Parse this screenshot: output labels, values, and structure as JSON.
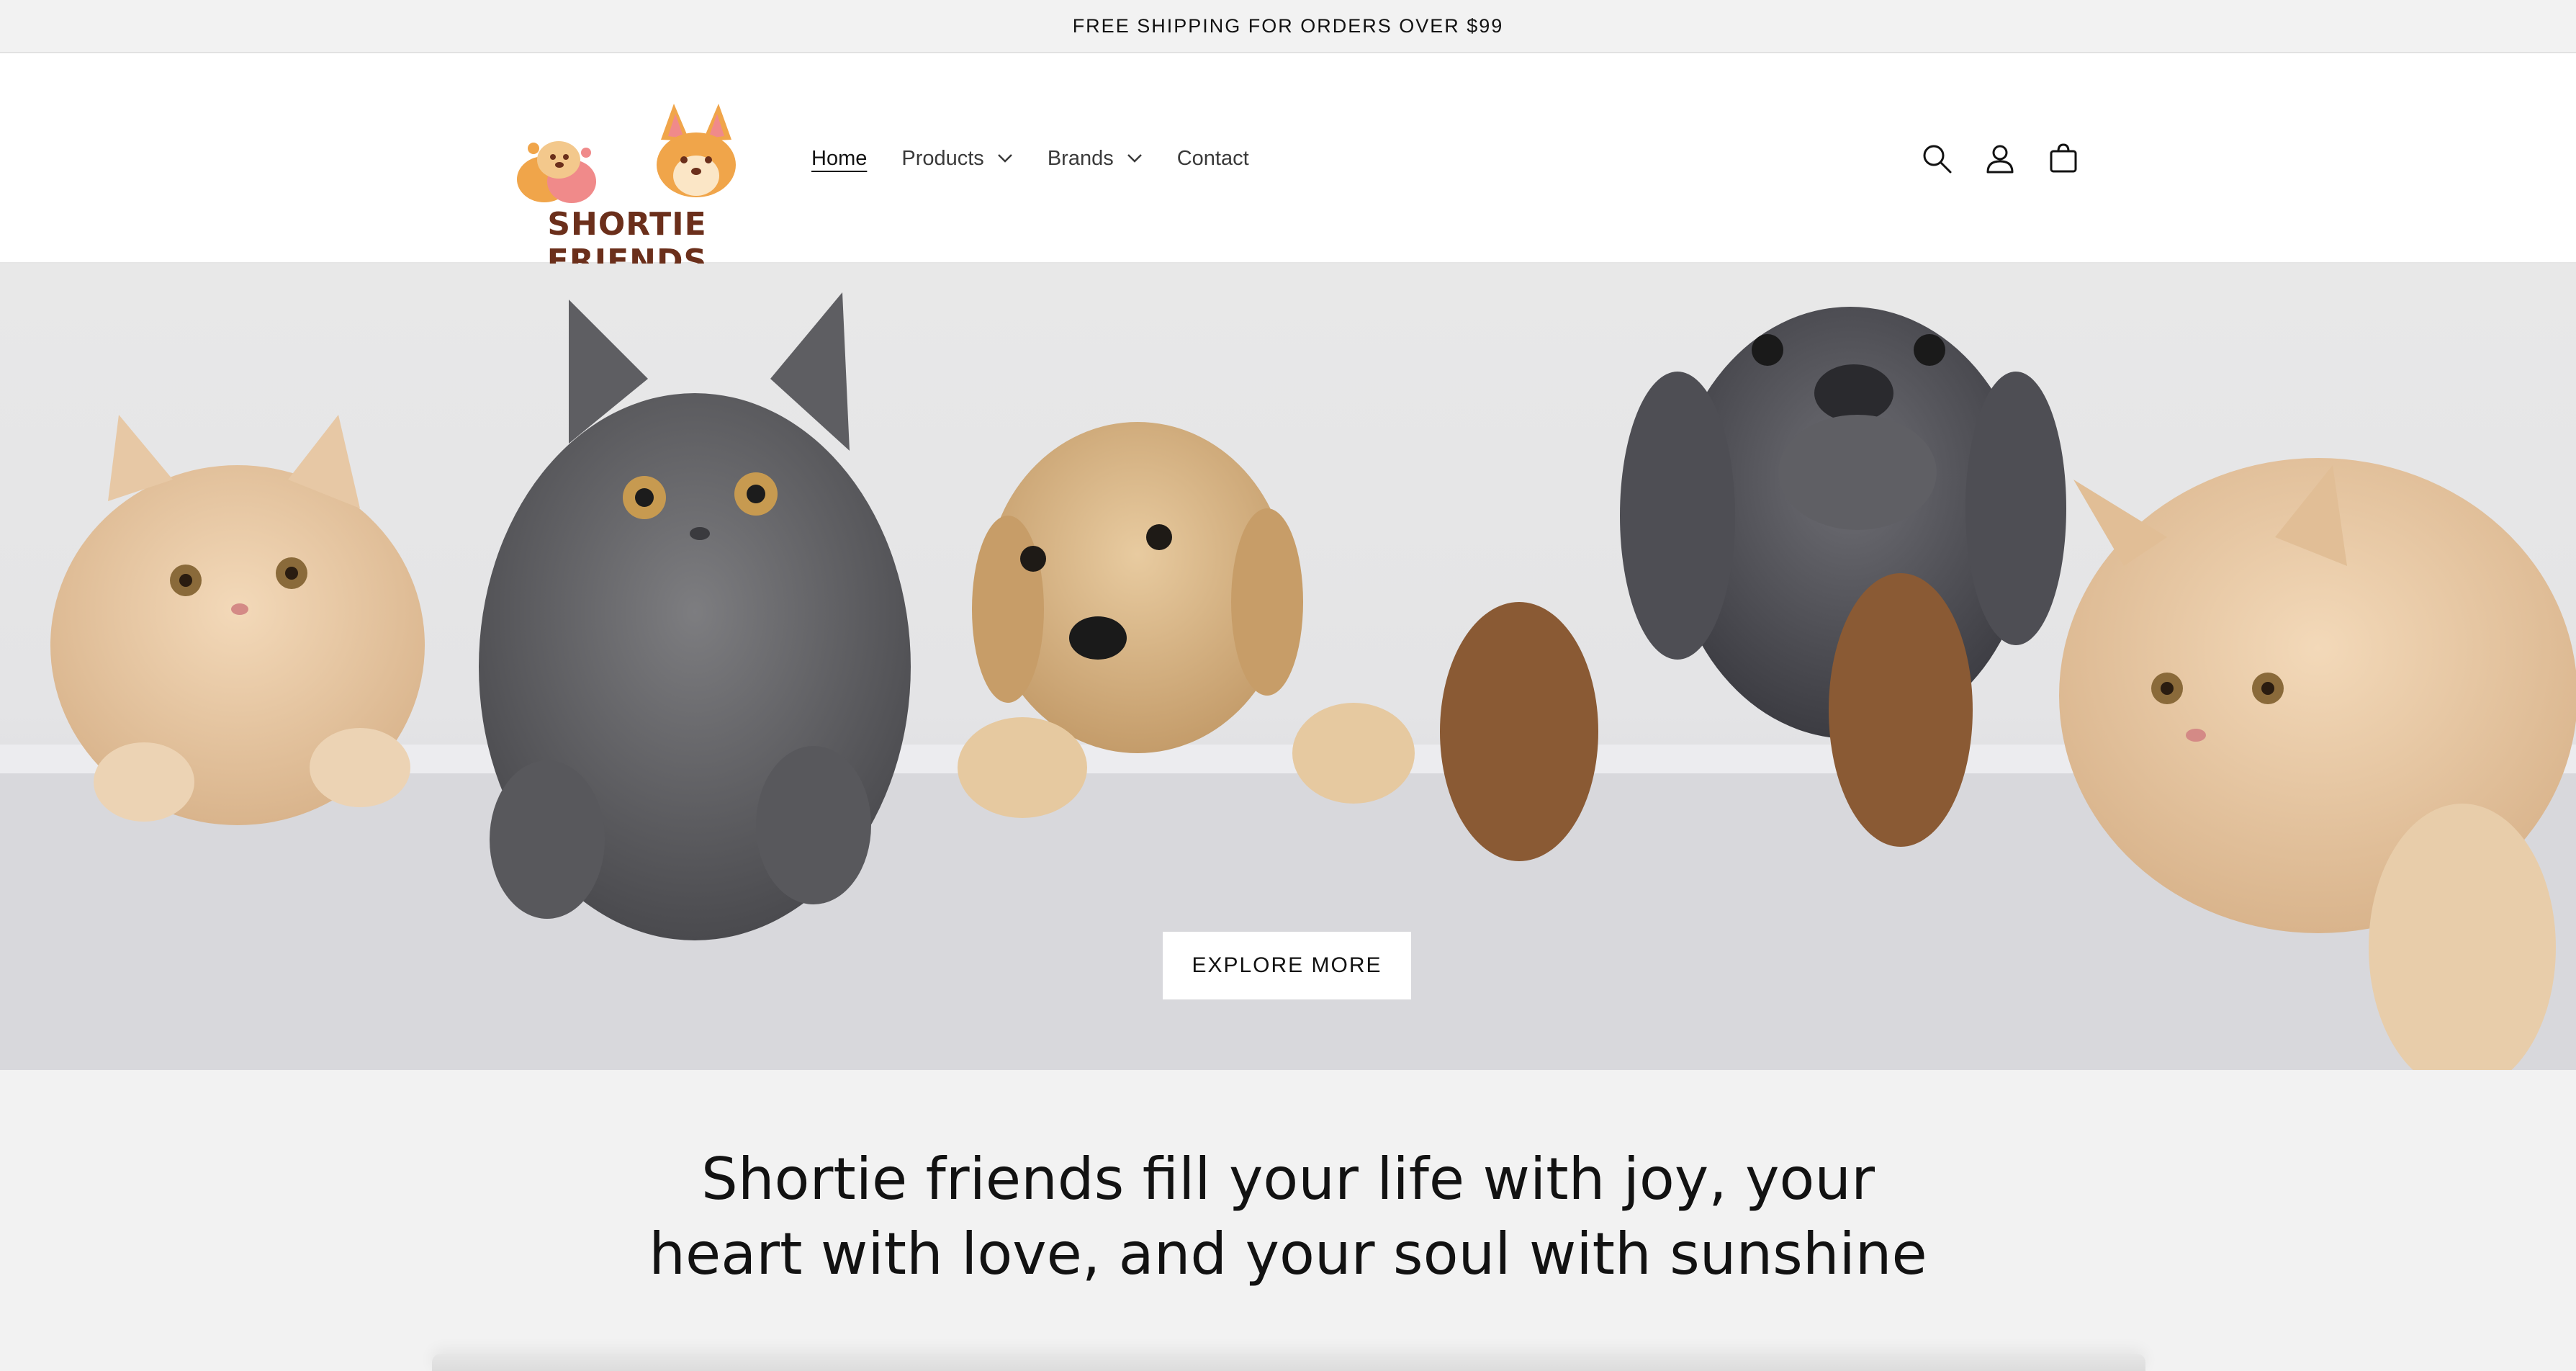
{
  "announcement": {
    "text": "FREE SHIPPING FOR ORDERS OVER $99"
  },
  "header": {
    "logo_text": "SHORTIE FRIENDS",
    "nav": [
      {
        "label": "Home",
        "active": true,
        "has_dropdown": false
      },
      {
        "label": "Products",
        "active": false,
        "has_dropdown": true
      },
      {
        "label": "Brands",
        "active": false,
        "has_dropdown": true
      },
      {
        "label": "Contact",
        "active": false,
        "has_dropdown": false
      }
    ],
    "icons": [
      "search-icon",
      "account-icon",
      "cart-icon"
    ]
  },
  "hero": {
    "button_label": "EXPLORE MORE",
    "animals": [
      "cream-kitten",
      "gray-kitten",
      "golden-puppy",
      "doberman-puppy",
      "cream-cat"
    ]
  },
  "main": {
    "tagline_line1": "Shortie friends fill your life with joy, your",
    "tagline_line2": "heart with love, and your soul with sunshine"
  },
  "colors": {
    "brand_brown": "#6b2f1b",
    "brand_orange": "#f0a54a",
    "brand_pink": "#f08a8a",
    "text": "#121212"
  }
}
